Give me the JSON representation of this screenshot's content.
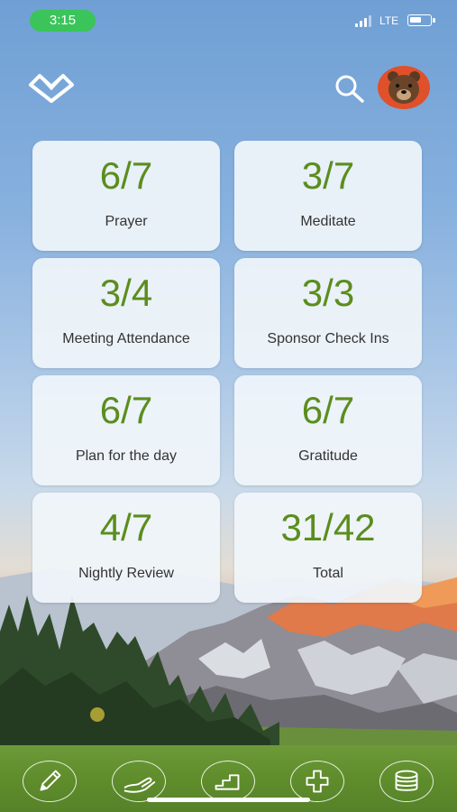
{
  "status_bar": {
    "time": "3:15",
    "network": "LTE"
  },
  "header": {
    "logo_icon": "heart-logo-icon",
    "search_icon": "search-icon",
    "avatar_icon": "bear-avatar-icon"
  },
  "stats": [
    {
      "value": "6/7",
      "label": "Prayer"
    },
    {
      "value": "3/7",
      "label": "Meditate"
    },
    {
      "value": "3/4",
      "label": "Meeting Attendance"
    },
    {
      "value": "3/3",
      "label": "Sponsor Check Ins"
    },
    {
      "value": "6/7",
      "label": "Plan for the day"
    },
    {
      "value": "6/7",
      "label": "Gratitude"
    },
    {
      "value": "4/7",
      "label": "Nightly Review"
    },
    {
      "value": "31/42",
      "label": "Total"
    }
  ],
  "bottom_nav": {
    "items": [
      {
        "icon": "pencil-icon"
      },
      {
        "icon": "hand-icon"
      },
      {
        "icon": "stairs-icon"
      },
      {
        "icon": "plus-icon"
      },
      {
        "icon": "coins-icon"
      }
    ]
  },
  "colors": {
    "accent_green": "#5b8d1e",
    "time_pill": "#3bc45a",
    "avatar_bg": "#e0502a",
    "nav_bar": "#5f8d2b"
  }
}
